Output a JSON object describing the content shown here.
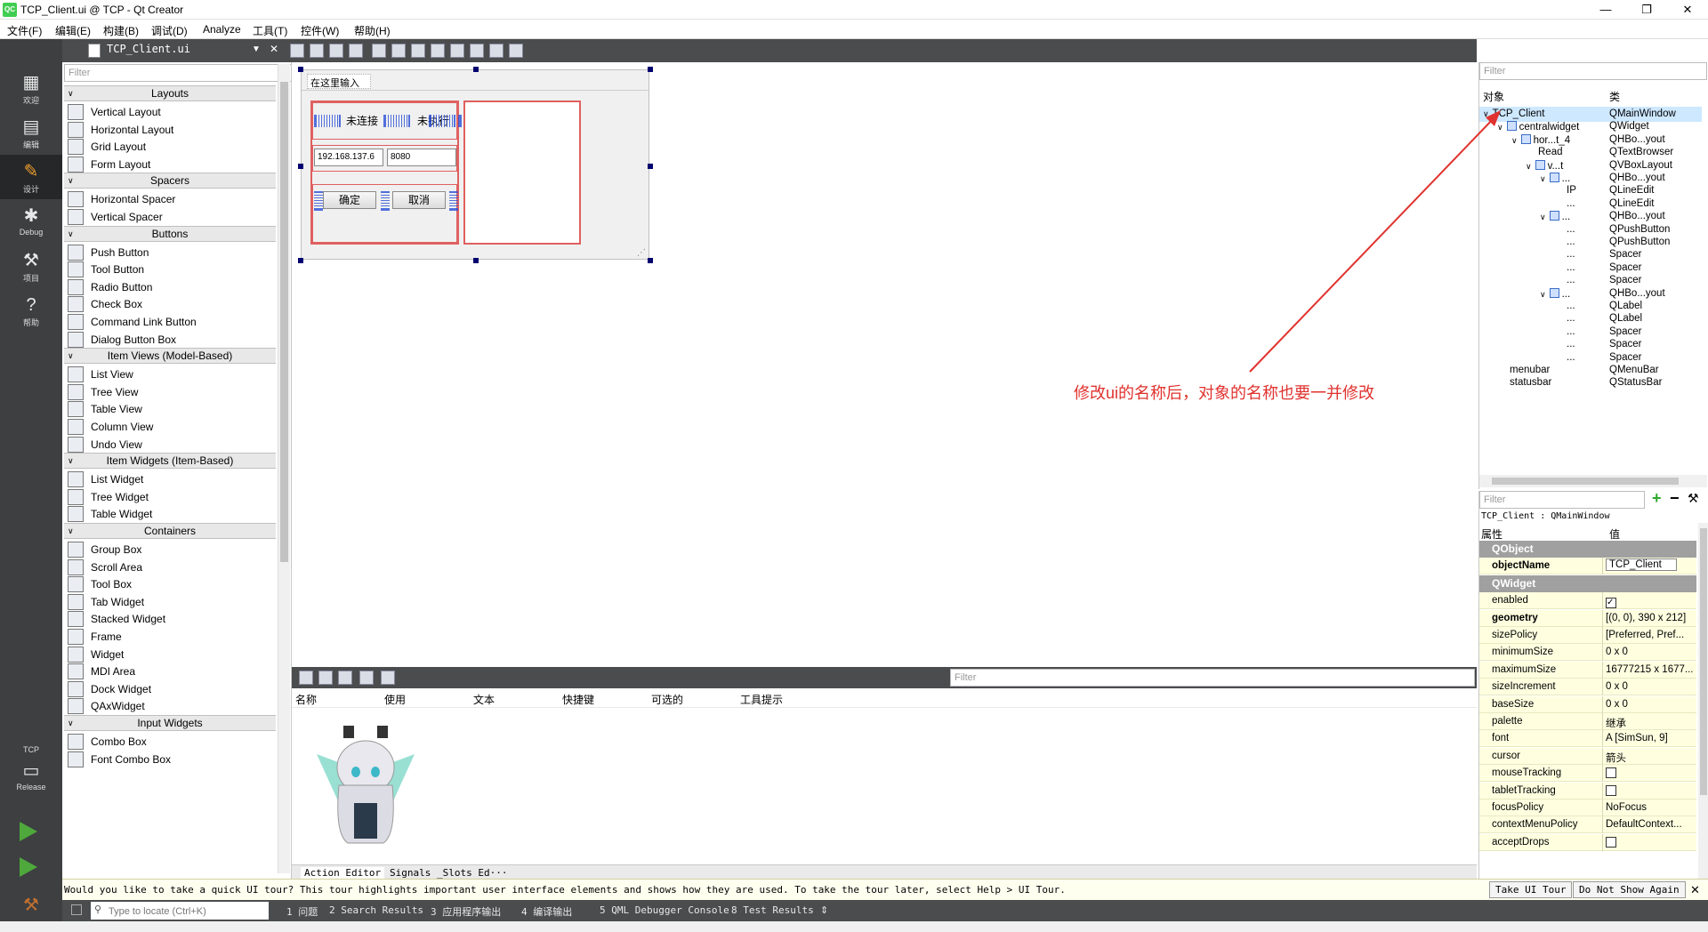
{
  "window": {
    "title": "TCP_Client.ui @ TCP - Qt Creator",
    "logo": "QC",
    "minimize": "—",
    "maximize": "❐",
    "close": "✕"
  },
  "menu": [
    "文件(F)",
    "编辑(E)",
    "构建(B)",
    "调试(D)",
    "Analyze",
    "工具(T)",
    "控件(W)",
    "帮助(H)"
  ],
  "modes": [
    {
      "label": "欢迎",
      "icon": "grid-icon"
    },
    {
      "label": "编辑",
      "icon": "edit-doc-icon"
    },
    {
      "label": "设计",
      "icon": "pencil-icon"
    },
    {
      "label": "Debug",
      "icon": "bug-icon"
    },
    {
      "label": "项目",
      "icon": "wrench-icon"
    },
    {
      "label": "帮助",
      "icon": "help-icon"
    }
  ],
  "kit": {
    "project": "TCP",
    "config": "Release"
  },
  "editor": {
    "doc_name": "TCP_Client.ui"
  },
  "widget_box": {
    "filter_placeholder": "Filter",
    "categories": [
      {
        "name": "Layouts",
        "items": [
          "Vertical Layout",
          "Horizontal Layout",
          "Grid Layout",
          "Form Layout"
        ]
      },
      {
        "name": "Spacers",
        "items": [
          "Horizontal Spacer",
          "Vertical Spacer"
        ]
      },
      {
        "name": "Buttons",
        "items": [
          "Push Button",
          "Tool Button",
          "Radio Button",
          "Check Box",
          "Command Link Button",
          "Dialog Button Box"
        ]
      },
      {
        "name": "Item Views (Model-Based)",
        "items": [
          "List View",
          "Tree View",
          "Table View",
          "Column View",
          "Undo View"
        ]
      },
      {
        "name": "Item Widgets (Item-Based)",
        "items": [
          "List Widget",
          "Tree Widget",
          "Table Widget"
        ]
      },
      {
        "name": "Containers",
        "items": [
          "Group Box",
          "Scroll Area",
          "Tool Box",
          "Tab Widget",
          "Stacked Widget",
          "Frame",
          "Widget",
          "MDI Area",
          "Dock Widget",
          "QAxWidget"
        ]
      },
      {
        "name": "Input Widgets",
        "items": [
          "Combo Box",
          "Font Combo Box"
        ]
      }
    ]
  },
  "form": {
    "menu_placeholder": "在这里输入",
    "label_status": "未连接",
    "label_exec": "未执行",
    "ip_value": "192.168.137.6",
    "port_value": "8080",
    "ok_button": "确定",
    "cancel_button": "取消"
  },
  "action_editor": {
    "filter_placeholder": "Filter",
    "columns": [
      "名称",
      "使用",
      "文本",
      "快捷键",
      "可选的",
      "工具提示"
    ],
    "tabs": [
      "Action Editor",
      "Signals _Slots Ed···"
    ]
  },
  "object_inspector": {
    "filter_placeholder": "Filter",
    "col_object": "对象",
    "col_class": "类",
    "rows": [
      {
        "name": "TCP_Client",
        "cls": "QMainWindow",
        "indent": 0,
        "arrow": "∨",
        "selected": true
      },
      {
        "name": "centralwidget",
        "cls": "QWidget",
        "indent": 1,
        "arrow": "∨",
        "icon": true
      },
      {
        "name": "hor...t_4",
        "cls": "QHBo...yout",
        "indent": 2,
        "arrow": "∨",
        "icon": true
      },
      {
        "name": "Read",
        "cls": "QTextBrowser",
        "indent": 3
      },
      {
        "name": "v...t",
        "cls": "QVBoxLayout",
        "indent": 3,
        "arrow": "∨",
        "icon": true
      },
      {
        "name": "...",
        "cls": "QHBo...yout",
        "indent": 4,
        "arrow": "∨",
        "icon": true
      },
      {
        "name": "IP",
        "cls": "QLineEdit",
        "indent": 5
      },
      {
        "name": "...",
        "cls": "QLineEdit",
        "indent": 5
      },
      {
        "name": "...",
        "cls": "QHBo...yout",
        "indent": 4,
        "arrow": "∨",
        "icon": true
      },
      {
        "name": "...",
        "cls": "QPushButton",
        "indent": 5
      },
      {
        "name": "...",
        "cls": "QPushButton",
        "indent": 5
      },
      {
        "name": "...",
        "cls": "Spacer",
        "indent": 5
      },
      {
        "name": "...",
        "cls": "Spacer",
        "indent": 5
      },
      {
        "name": "...",
        "cls": "Spacer",
        "indent": 5
      },
      {
        "name": "...",
        "cls": "QHBo...yout",
        "indent": 4,
        "arrow": "∨",
        "icon": true
      },
      {
        "name": "...",
        "cls": "QLabel",
        "indent": 5
      },
      {
        "name": "...",
        "cls": "QLabel",
        "indent": 5
      },
      {
        "name": "...",
        "cls": "Spacer",
        "indent": 5
      },
      {
        "name": "...",
        "cls": "Spacer",
        "indent": 5
      },
      {
        "name": "...",
        "cls": "Spacer",
        "indent": 5
      },
      {
        "name": "menubar",
        "cls": "QMenuBar",
        "indent": 1
      },
      {
        "name": "statusbar",
        "cls": "QStatusBar",
        "indent": 1
      }
    ]
  },
  "property_editor": {
    "filter_placeholder": "Filter",
    "title": "TCP_Client : QMainWindow",
    "col_prop": "属性",
    "col_value": "值",
    "rows": [
      {
        "section": "QObject"
      },
      {
        "k": "objectName",
        "v": "TCP_Client",
        "bold": true,
        "edit": true
      },
      {
        "section": "QWidget"
      },
      {
        "k": "enabled",
        "check": true
      },
      {
        "k": "geometry",
        "v": "[(0, 0), 390 x 212]",
        "bold": true
      },
      {
        "k": "sizePolicy",
        "v": "[Preferred, Pref..."
      },
      {
        "k": "minimumSize",
        "v": "0 x 0"
      },
      {
        "k": "maximumSize",
        "v": "16777215 x 1677..."
      },
      {
        "k": "sizeIncrement",
        "v": "0 x 0"
      },
      {
        "k": "baseSize",
        "v": "0 x 0"
      },
      {
        "k": "palette",
        "v": "继承"
      },
      {
        "k": "font",
        "v": "A  [SimSun, 9]"
      },
      {
        "k": "cursor",
        "v": "箭头"
      },
      {
        "k": "mouseTracking",
        "check": false
      },
      {
        "k": "tabletTracking",
        "check": false
      },
      {
        "k": "focusPolicy",
        "v": "NoFocus"
      },
      {
        "k": "contextMenuPolicy",
        "v": "DefaultContext..."
      },
      {
        "k": "acceptDrops",
        "check": false
      }
    ]
  },
  "tour": {
    "message": "Would you like to take a quick UI tour? This tour highlights important user interface elements and shows how they are used. To take the tour later, select Help > UI Tour.",
    "take": "Take UI Tour",
    "dont_show": "Do Not Show Again"
  },
  "statusbar": {
    "locate_placeholder": "Type to locate (Ctrl+K)",
    "panes": [
      "1 问题",
      "2 Search Results",
      "3 应用程序输出",
      "4 编译输出",
      "5 QML Debugger Console",
      "8 Test Results"
    ]
  },
  "annotation": "修改ui的名称后，对象的名称也要一并修改",
  "colors": {
    "annotation": "#e0322e",
    "mode_bar": "#3d3f41",
    "selected": "#cde8ff",
    "property_bg": "#ffffe0"
  }
}
